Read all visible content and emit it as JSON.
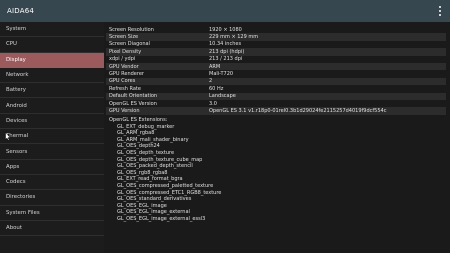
{
  "app": {
    "title": "AIDA64"
  },
  "sidebar": {
    "items": [
      {
        "label": "System"
      },
      {
        "label": "CPU"
      },
      {
        "label": "Display"
      },
      {
        "label": "Network"
      },
      {
        "label": "Battery"
      },
      {
        "label": "Android"
      },
      {
        "label": "Devices"
      },
      {
        "label": "Thermal"
      },
      {
        "label": "Sensors"
      },
      {
        "label": "Apps"
      },
      {
        "label": "Codecs"
      },
      {
        "label": "Directories"
      },
      {
        "label": "System Files"
      },
      {
        "label": "About"
      }
    ],
    "active": "Display"
  },
  "display_info": {
    "rows": [
      {
        "key": "Screen Resolution",
        "value": "1920 × 1080"
      },
      {
        "key": "Screen Size",
        "value": "229 mm × 129 mm"
      },
      {
        "key": "Screen Diagonal",
        "value": "10.34 inches"
      },
      {
        "key": "Pixel Density",
        "value": "213 dpi (hdpi)"
      },
      {
        "key": "xdpi / ydpi",
        "value": "213 / 213 dpi"
      },
      {
        "key": "GPU Vendor",
        "value": "ARM"
      },
      {
        "key": "GPU Renderer",
        "value": "Mali-T720"
      },
      {
        "key": "GPU Cores",
        "value": "2"
      },
      {
        "key": "Refresh Rate",
        "value": "60 Hz"
      },
      {
        "key": "Default Orientation",
        "value": "Landscape"
      },
      {
        "key": "OpenGL ES Version",
        "value": "3.0"
      },
      {
        "key": "GPU Version",
        "value": "OpenGL ES 3.1 v1.r18p0-01rel0.3b1d29024fe2115257d4019f9dcf554c"
      }
    ],
    "extensions_label": "OpenGL ES Extensions:",
    "extensions": [
      "GL_EXT_debug_marker",
      "GL_ARM_rgba8",
      "GL_ARM_mali_shader_binary",
      "GL_OES_depth24",
      "GL_OES_depth_texture",
      "GL_OES_depth_texture_cube_map",
      "GL_OES_packed_depth_stencil",
      "GL_OES_rgb8_rgba8",
      "GL_EXT_read_format_bgra",
      "GL_OES_compressed_paletted_texture",
      "GL_OES_compressed_ETC1_RGB8_texture",
      "GL_OES_standard_derivatives",
      "GL_OES_EGL_image",
      "GL_OES_EGL_image_external",
      "GL_OES_EGL_image_external_essl3"
    ]
  },
  "icons": {
    "overflow_menu": "more-vert-icon",
    "cursor": "mouse-pointer-icon"
  },
  "colors": {
    "appbar": "#37474f",
    "active_item": "#9c5a5d",
    "background": "#1a1a1a"
  }
}
